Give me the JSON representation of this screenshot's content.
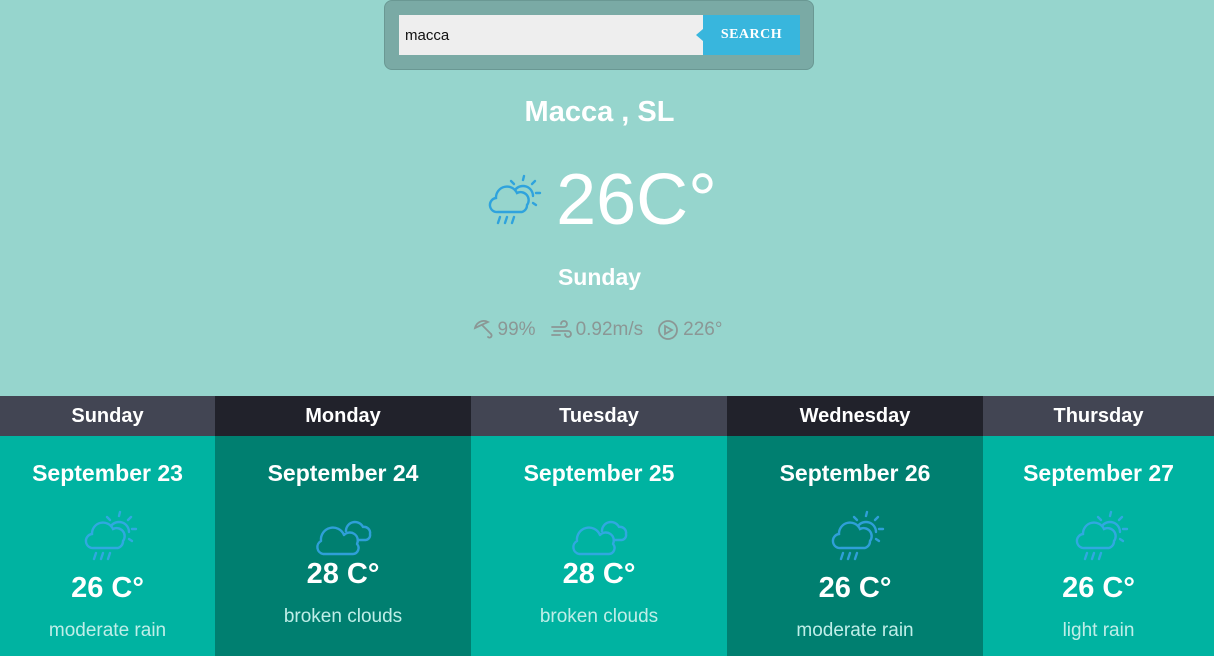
{
  "search": {
    "value": "macca",
    "button_label": "SEARCH"
  },
  "current": {
    "city": "Macca , SL",
    "icon": "rain-sun-cloud-icon",
    "temperature": "26C°",
    "day": "Sunday",
    "humidity": "99%",
    "wind_speed": "0.92m/s",
    "wind_direction": "226°"
  },
  "forecast": [
    {
      "day": "Sunday",
      "date": "September 23",
      "icon": "rain-sun-cloud-icon",
      "temp": "26 C°",
      "desc": "moderate rain"
    },
    {
      "day": "Monday",
      "date": "September 24",
      "icon": "broken-clouds-icon",
      "temp": "28 C°",
      "desc": "broken clouds"
    },
    {
      "day": "Tuesday",
      "date": "September 25",
      "icon": "broken-clouds-icon",
      "temp": "28 C°",
      "desc": "broken clouds"
    },
    {
      "day": "Wednesday",
      "date": "September 26",
      "icon": "rain-sun-cloud-icon",
      "temp": "26 C°",
      "desc": "moderate rain"
    },
    {
      "day": "Thursday",
      "date": "September 27",
      "icon": "rain-sun-cloud-icon",
      "temp": "26 C°",
      "desc": "light rain"
    }
  ],
  "colors": {
    "background": "#96d5cd",
    "accent": "#38b6dd",
    "forecast_light": "#00b3a1",
    "forecast_dark": "#007f70",
    "header_light": "#424553",
    "header_dark": "#21222b"
  }
}
